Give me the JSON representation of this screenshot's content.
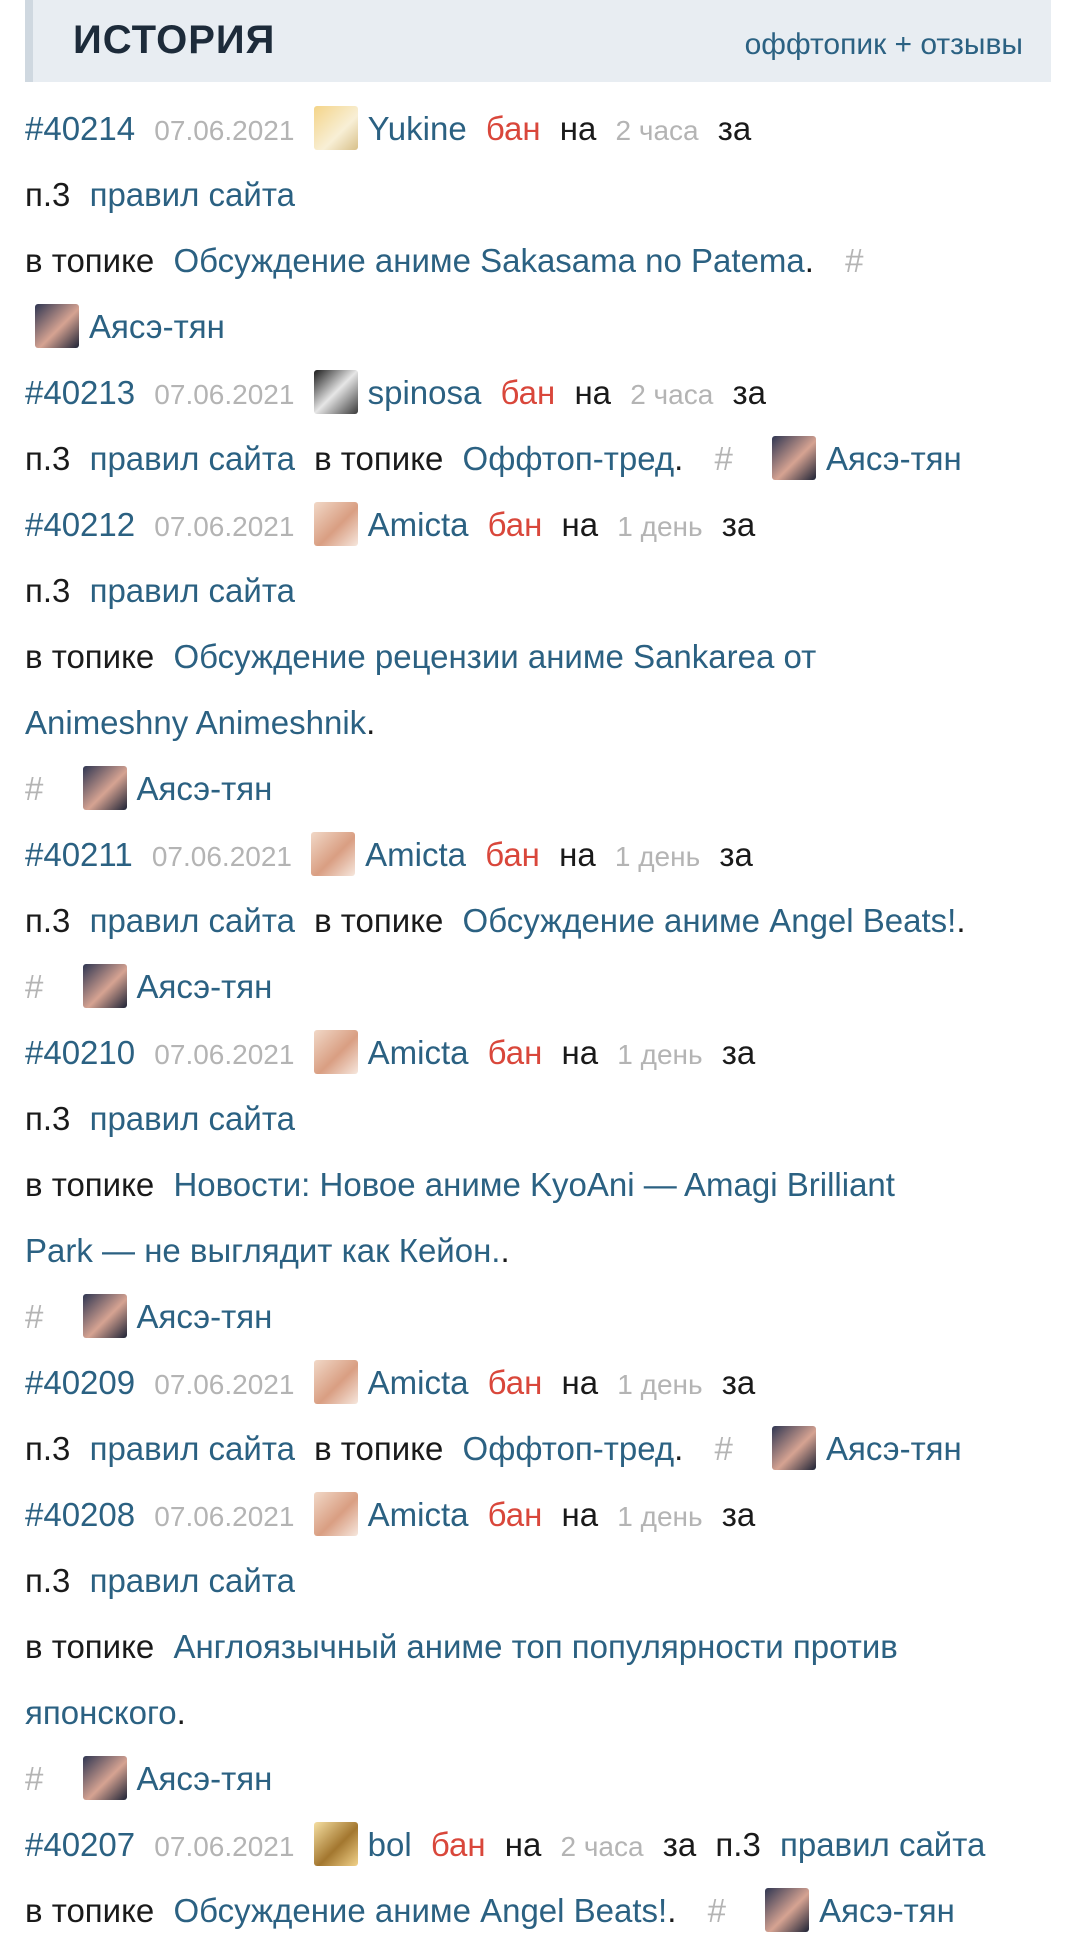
{
  "header": {
    "title": "ИСТОРИЯ",
    "tab": "оффтопик + отзывы"
  },
  "words": {
    "ban": "бан",
    "on": "на",
    "for": "за",
    "rule_num": "п.3",
    "rules": "правил сайта",
    "in_topic": "в топике",
    "dot": ".",
    "hash": "#"
  },
  "entries": [
    {
      "id": "#40214",
      "date": "07.06.2021",
      "user": "Yukine",
      "avatar_icon": "avatar-yukine",
      "duration": "2 часа",
      "topic_line1": "Обсуждение аниме Sakasama no Patema",
      "topic_line2": "",
      "moderator": "Аясэ-тян"
    },
    {
      "id": "#40213",
      "date": "07.06.2021",
      "user": "spinosa",
      "avatar_icon": "avatar-spinosa",
      "duration": "2 часа",
      "topic_line1": "Оффтоп-тред",
      "topic_line2": "",
      "moderator": "Аясэ-тян"
    },
    {
      "id": "#40212",
      "date": "07.06.2021",
      "user": "Amicta",
      "avatar_icon": "avatar-amicta",
      "duration": "1 день",
      "topic_line1": "Обсуждение рецензии аниме Sankarea от",
      "topic_line2": "Animeshny Animeshnik",
      "moderator": "Аясэ-тян"
    },
    {
      "id": "#40211",
      "date": "07.06.2021",
      "user": "Amicta",
      "avatar_icon": "avatar-amicta",
      "duration": "1 день",
      "topic_line1": "Обсуждение аниме Angel Beats!",
      "topic_line2": "",
      "moderator": "Аясэ-тян"
    },
    {
      "id": "#40210",
      "date": "07.06.2021",
      "user": "Amicta",
      "avatar_icon": "avatar-amicta",
      "duration": "1 день",
      "topic_line1": "Новости: Новое аниме KyoAni — Amagi Brilliant",
      "topic_line2": "Park — не выглядит как Кейон.",
      "moderator": "Аясэ-тян"
    },
    {
      "id": "#40209",
      "date": "07.06.2021",
      "user": "Amicta",
      "avatar_icon": "avatar-amicta",
      "duration": "1 день",
      "topic_line1": "Оффтоп-тред",
      "topic_line2": "",
      "moderator": "Аясэ-тян"
    },
    {
      "id": "#40208",
      "date": "07.06.2021",
      "user": "Amicta",
      "avatar_icon": "avatar-amicta",
      "duration": "1 день",
      "topic_line1": "Англоязычный аниме топ популярности против",
      "topic_line2": "японского",
      "moderator": "Аясэ-тян"
    },
    {
      "id": "#40207",
      "date": "07.06.2021",
      "user": "bol",
      "avatar_icon": "avatar-bol",
      "duration": "2 часа",
      "topic_line1": "Обсуждение аниме Angel Beats!",
      "topic_line2": "",
      "moderator": "Аясэ-тян"
    }
  ]
}
